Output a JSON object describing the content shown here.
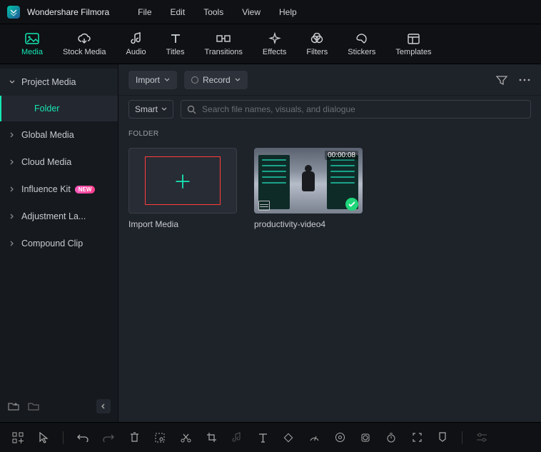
{
  "app": {
    "name": "Wondershare Filmora"
  },
  "menu": [
    "File",
    "Edit",
    "Tools",
    "View",
    "Help"
  ],
  "toolbar": [
    {
      "key": "media",
      "label": "Media",
      "active": true
    },
    {
      "key": "stock",
      "label": "Stock Media"
    },
    {
      "key": "audio",
      "label": "Audio"
    },
    {
      "key": "titles",
      "label": "Titles"
    },
    {
      "key": "transitions",
      "label": "Transitions"
    },
    {
      "key": "effects",
      "label": "Effects"
    },
    {
      "key": "filters",
      "label": "Filters"
    },
    {
      "key": "stickers",
      "label": "Stickers"
    },
    {
      "key": "templates",
      "label": "Templates"
    }
  ],
  "sidebar": {
    "items": [
      {
        "label": "Project Media",
        "expanded": true
      },
      {
        "label": "Global Media"
      },
      {
        "label": "Cloud Media"
      },
      {
        "label": "Influence Kit",
        "badge": "NEW"
      },
      {
        "label": "Adjustment La..."
      },
      {
        "label": "Compound Clip"
      }
    ],
    "sub": "Folder"
  },
  "content": {
    "import_label": "Import",
    "record_label": "Record",
    "smart_label": "Smart",
    "search_placeholder": "Search file names, visuals, and dialogue",
    "section": "FOLDER",
    "cards": {
      "import": "Import Media",
      "video": {
        "name": "productivity-video4",
        "duration": "00:00:08"
      }
    }
  }
}
